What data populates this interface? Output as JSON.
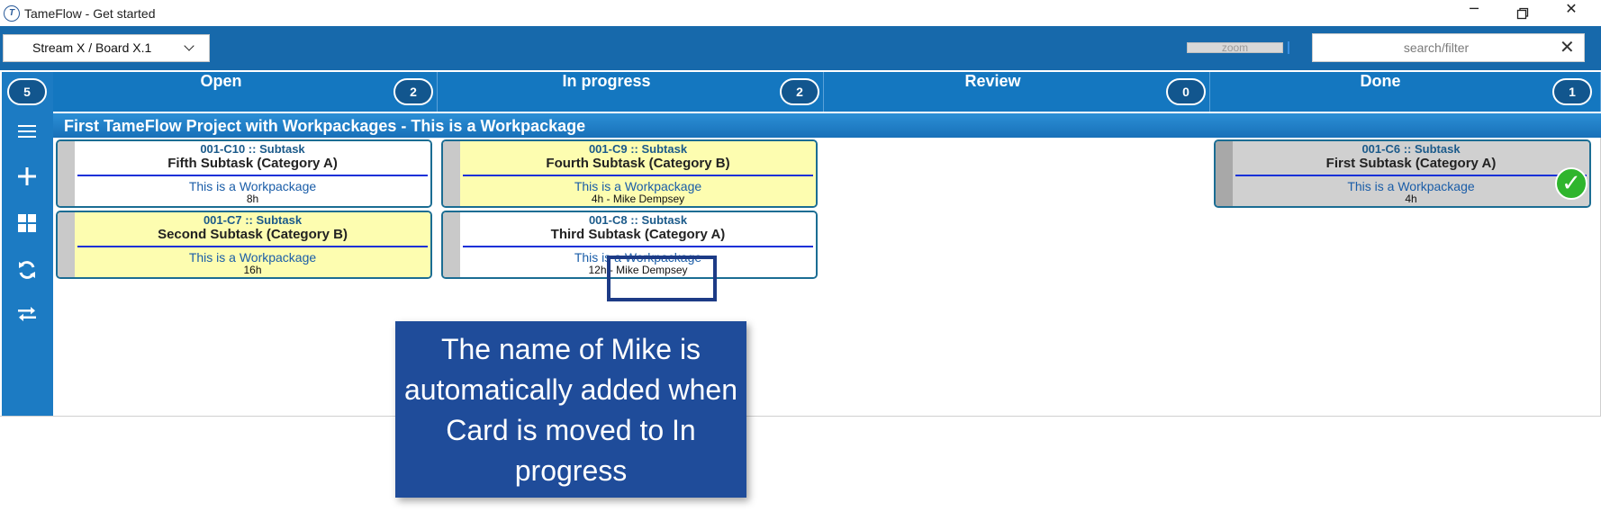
{
  "window": {
    "title": "TameFlow - Get started",
    "icon_glyph": "T"
  },
  "toolbar": {
    "board_selector": "Stream X / Board X.1",
    "zoom_label": "zoom",
    "search_placeholder": "search/filter"
  },
  "sidebar": {
    "wip_total": "5",
    "icons": [
      "menu-icon",
      "add-icon",
      "layout-icon",
      "refresh-icon",
      "swap-icon"
    ]
  },
  "columns": [
    {
      "title": "Open",
      "count": "2"
    },
    {
      "title": "In progress",
      "count": "2"
    },
    {
      "title": "Review",
      "count": "0"
    },
    {
      "title": "Done",
      "count": "1"
    }
  ],
  "swimlane": {
    "title": "First TameFlow Project with Workpackages - This is a Workpackage"
  },
  "cards": [
    {
      "id": "001-C10 :: Subtask",
      "title": "Fifth Subtask (Category A)",
      "workpackage": "This is a Workpackage",
      "meta": "8h",
      "column": "Open",
      "color": "#ffffff"
    },
    {
      "id": "001-C7 :: Subtask",
      "title": "Second Subtask (Category B)",
      "workpackage": "This is a Workpackage",
      "meta": "16h",
      "column": "Open",
      "color": "#fdfdb0"
    },
    {
      "id": "001-C9 :: Subtask",
      "title": "Fourth Subtask (Category B)",
      "workpackage": "This is a Workpackage",
      "meta": "4h - Mike Dempsey",
      "column": "In progress",
      "color": "#fdfdb0"
    },
    {
      "id": "001-C8 :: Subtask",
      "title": "Third Subtask (Category A)",
      "workpackage": "This is a Workpackage",
      "meta": "12h - Mike Dempsey",
      "column": "In progress",
      "color": "#ffffff"
    },
    {
      "id": "001-C6 :: Subtask",
      "title": "First Subtask (Category A)",
      "workpackage": "This is a Workpackage",
      "meta": "4h",
      "column": "Done",
      "color": "#d0d0d0"
    }
  ],
  "annotation": {
    "text": "The name of Mike is automatically added when Card is moved to In progress"
  },
  "colors": {
    "toolbar": "#1769ab",
    "header": "#1477c0",
    "card_border": "#1b6d93",
    "done_check": "#2fb52d"
  }
}
